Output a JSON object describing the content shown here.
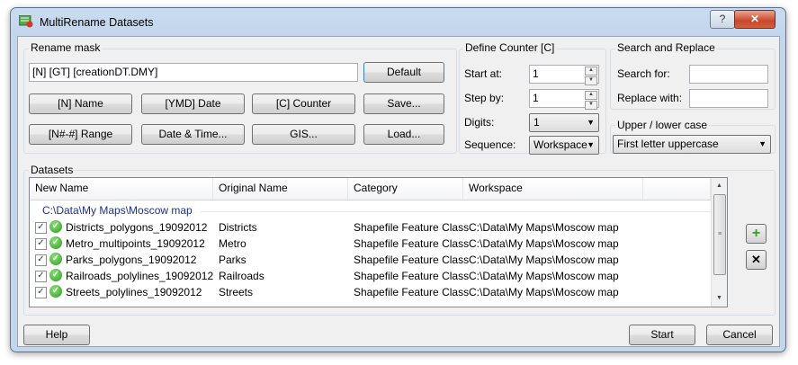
{
  "window": {
    "title": "MultiRename Datasets",
    "help_label": "?",
    "close_label": "✕"
  },
  "rename_mask": {
    "group_label": "Rename mask",
    "mask_value": "[N] [GT] [creationDT.DMY]",
    "default_label": "Default",
    "buttons": [
      "[N] Name",
      "[YMD] Date",
      "[C] Counter",
      "Save...",
      "[N#-#] Range",
      "Date & Time...",
      "GIS...",
      "Load..."
    ]
  },
  "counter": {
    "group_label": "Define Counter [C]",
    "start_label": "Start at:",
    "start_value": "1",
    "step_label": "Step by:",
    "step_value": "1",
    "digits_label": "Digits:",
    "digits_value": "1",
    "sequence_label": "Sequence:",
    "sequence_value": "Workspace"
  },
  "search": {
    "group_label": "Search and Replace",
    "search_label": "Search for:",
    "search_value": "",
    "replace_label": "Replace with:",
    "replace_value": ""
  },
  "case": {
    "group_label": "Upper / lower case",
    "value": "First letter uppercase"
  },
  "datasets": {
    "group_label": "Datasets",
    "columns": [
      "New Name",
      "Original Name",
      "Category",
      "Workspace"
    ],
    "group_header": "C:\\Data\\My Maps\\Moscow map",
    "rows": [
      {
        "new": "Districts_polygons_19092012",
        "orig": "Districts",
        "cat": "Shapefile Feature Class",
        "ws": "C:\\Data\\My Maps\\Moscow map"
      },
      {
        "new": "Metro_multipoints_19092012",
        "orig": "Metro",
        "cat": "Shapefile Feature Class",
        "ws": "C:\\Data\\My Maps\\Moscow map"
      },
      {
        "new": "Parks_polygons_19092012",
        "orig": "Parks",
        "cat": "Shapefile Feature Class",
        "ws": "C:\\Data\\My Maps\\Moscow map"
      },
      {
        "new": "Railroads_polylines_19092012",
        "orig": "Railroads",
        "cat": "Shapefile Feature Class",
        "ws": "C:\\Data\\My Maps\\Moscow map"
      },
      {
        "new": "Streets_polylines_19092012",
        "orig": "Streets",
        "cat": "Shapefile Feature Class",
        "ws": "C:\\Data\\My Maps\\Moscow map"
      }
    ]
  },
  "footer": {
    "help_label": "Help",
    "start_label": "Start",
    "cancel_label": "Cancel"
  }
}
